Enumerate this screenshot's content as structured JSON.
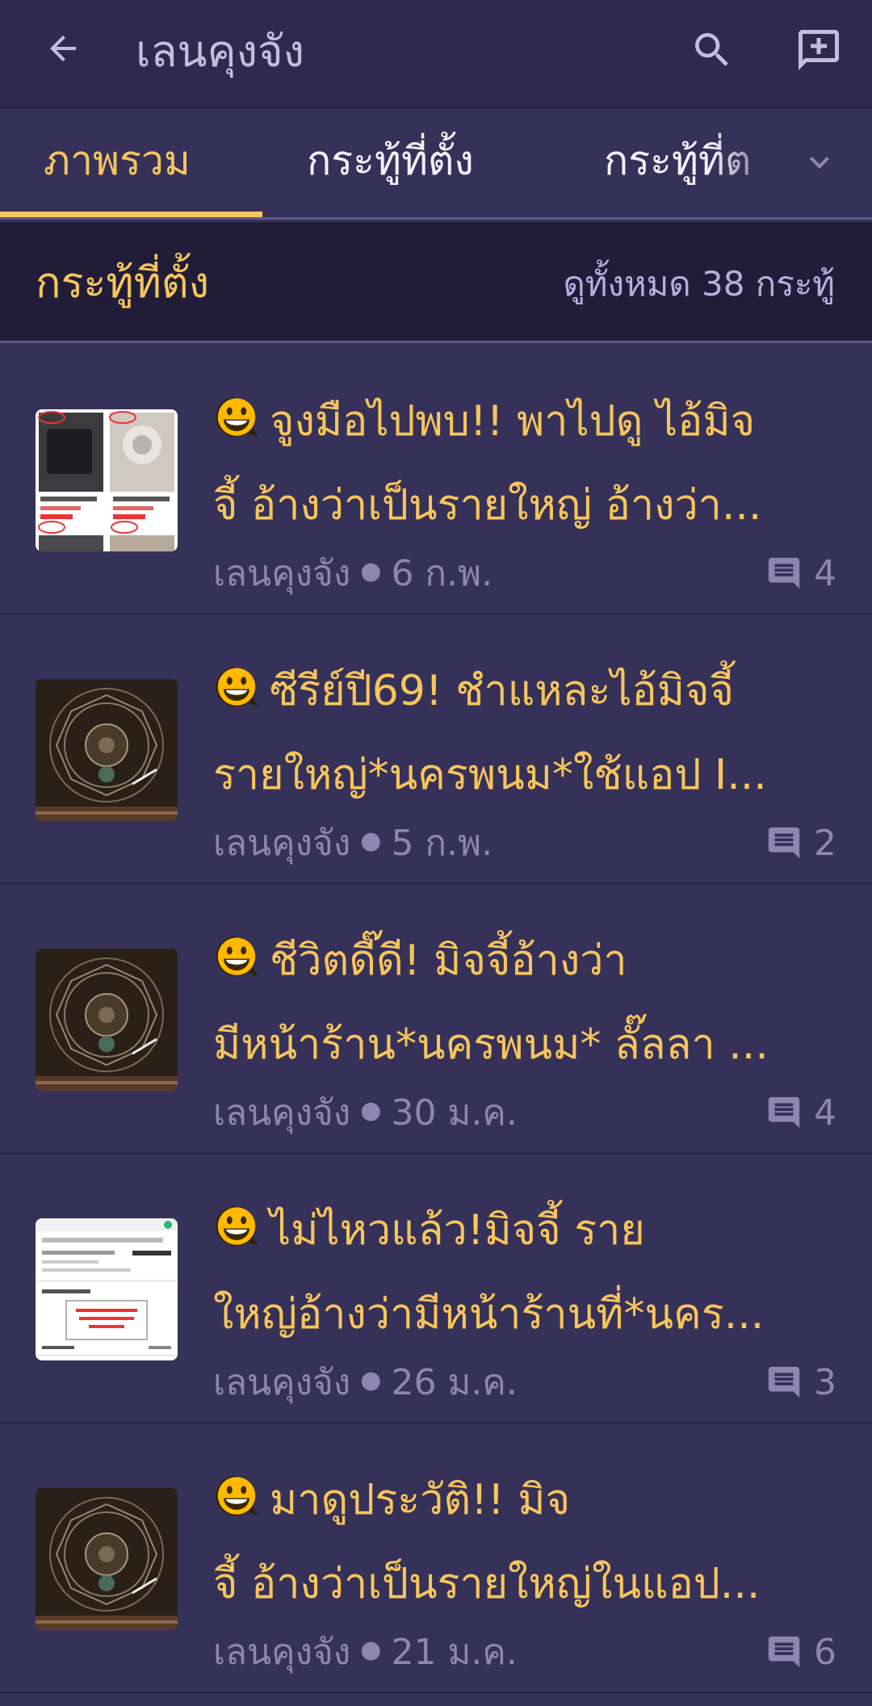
{
  "appbar": {
    "title": "เลนคุงจัง",
    "back_icon": "arrow-back-icon",
    "search_icon": "search-icon",
    "new_post_icon": "add-post-icon"
  },
  "tabs": [
    {
      "label": "ภาพรวม",
      "active": true
    },
    {
      "label": "กระทู้ที่ตั้ง",
      "active": false
    },
    {
      "label": "กระทู้ที่ต",
      "active": false
    }
  ],
  "tabs_more_icon": "chevron-down-icon",
  "section": {
    "title": "กระทู้ที่ตั้ง",
    "view_all": "ดูทั้งหมด 38 กระทู้"
  },
  "posts": [
    {
      "line1": "จูงมือไปพบ!! พาไปดู ไอ้มิจ",
      "line2": "จี้ อ้างว่าเป็นรายใหญ่ อ้างว่า...",
      "author": "เลนคุงจัง",
      "date": "6 ก.พ.",
      "comments": "4",
      "thumbnail": "product-listing-screenshot"
    },
    {
      "line1": "ซีรีย์ปี69! ชำแหละไอ้มิจจี้",
      "line2": "รายใหญ่*นครพนม*ใช้แอป I...",
      "author": "เลนคุงจัง",
      "date": "5 ก.พ.",
      "comments": "2",
      "thumbnail": "ornamental-mandala-image"
    },
    {
      "line1": "ชีวิตดี๊ดี! มิจจี้อ้างว่า",
      "line2": "มีหน้าร้าน*นครพนม* ลั๊ลลา ...",
      "author": "เลนคุงจัง",
      "date": "30 ม.ค.",
      "comments": "4",
      "thumbnail": "ornamental-mandala-image"
    },
    {
      "line1": "ไม่ไหวแล้ว!มิจจี้ ราย",
      "line2": "ใหญ่อ้างว่ามีหน้าร้านที่*นคร...",
      "author": "เลนคุงจัง",
      "date": "26 ม.ค.",
      "comments": "3",
      "thumbnail": "order-details-screenshot"
    },
    {
      "line1": "มาดูประวัติ!! มิจ",
      "line2": "จี้ อ้างว่าเป็นรายใหญ่ในแอป...",
      "author": "เลนคุงจัง",
      "date": "21 ม.ค.",
      "comments": "6",
      "thumbnail": "ornamental-mandala-image"
    }
  ],
  "colors": {
    "background": "#363158",
    "appbar": "#2f2a4d",
    "section_bg": "#211d38",
    "accent": "#f6c55c",
    "muted": "#8d86b3"
  }
}
